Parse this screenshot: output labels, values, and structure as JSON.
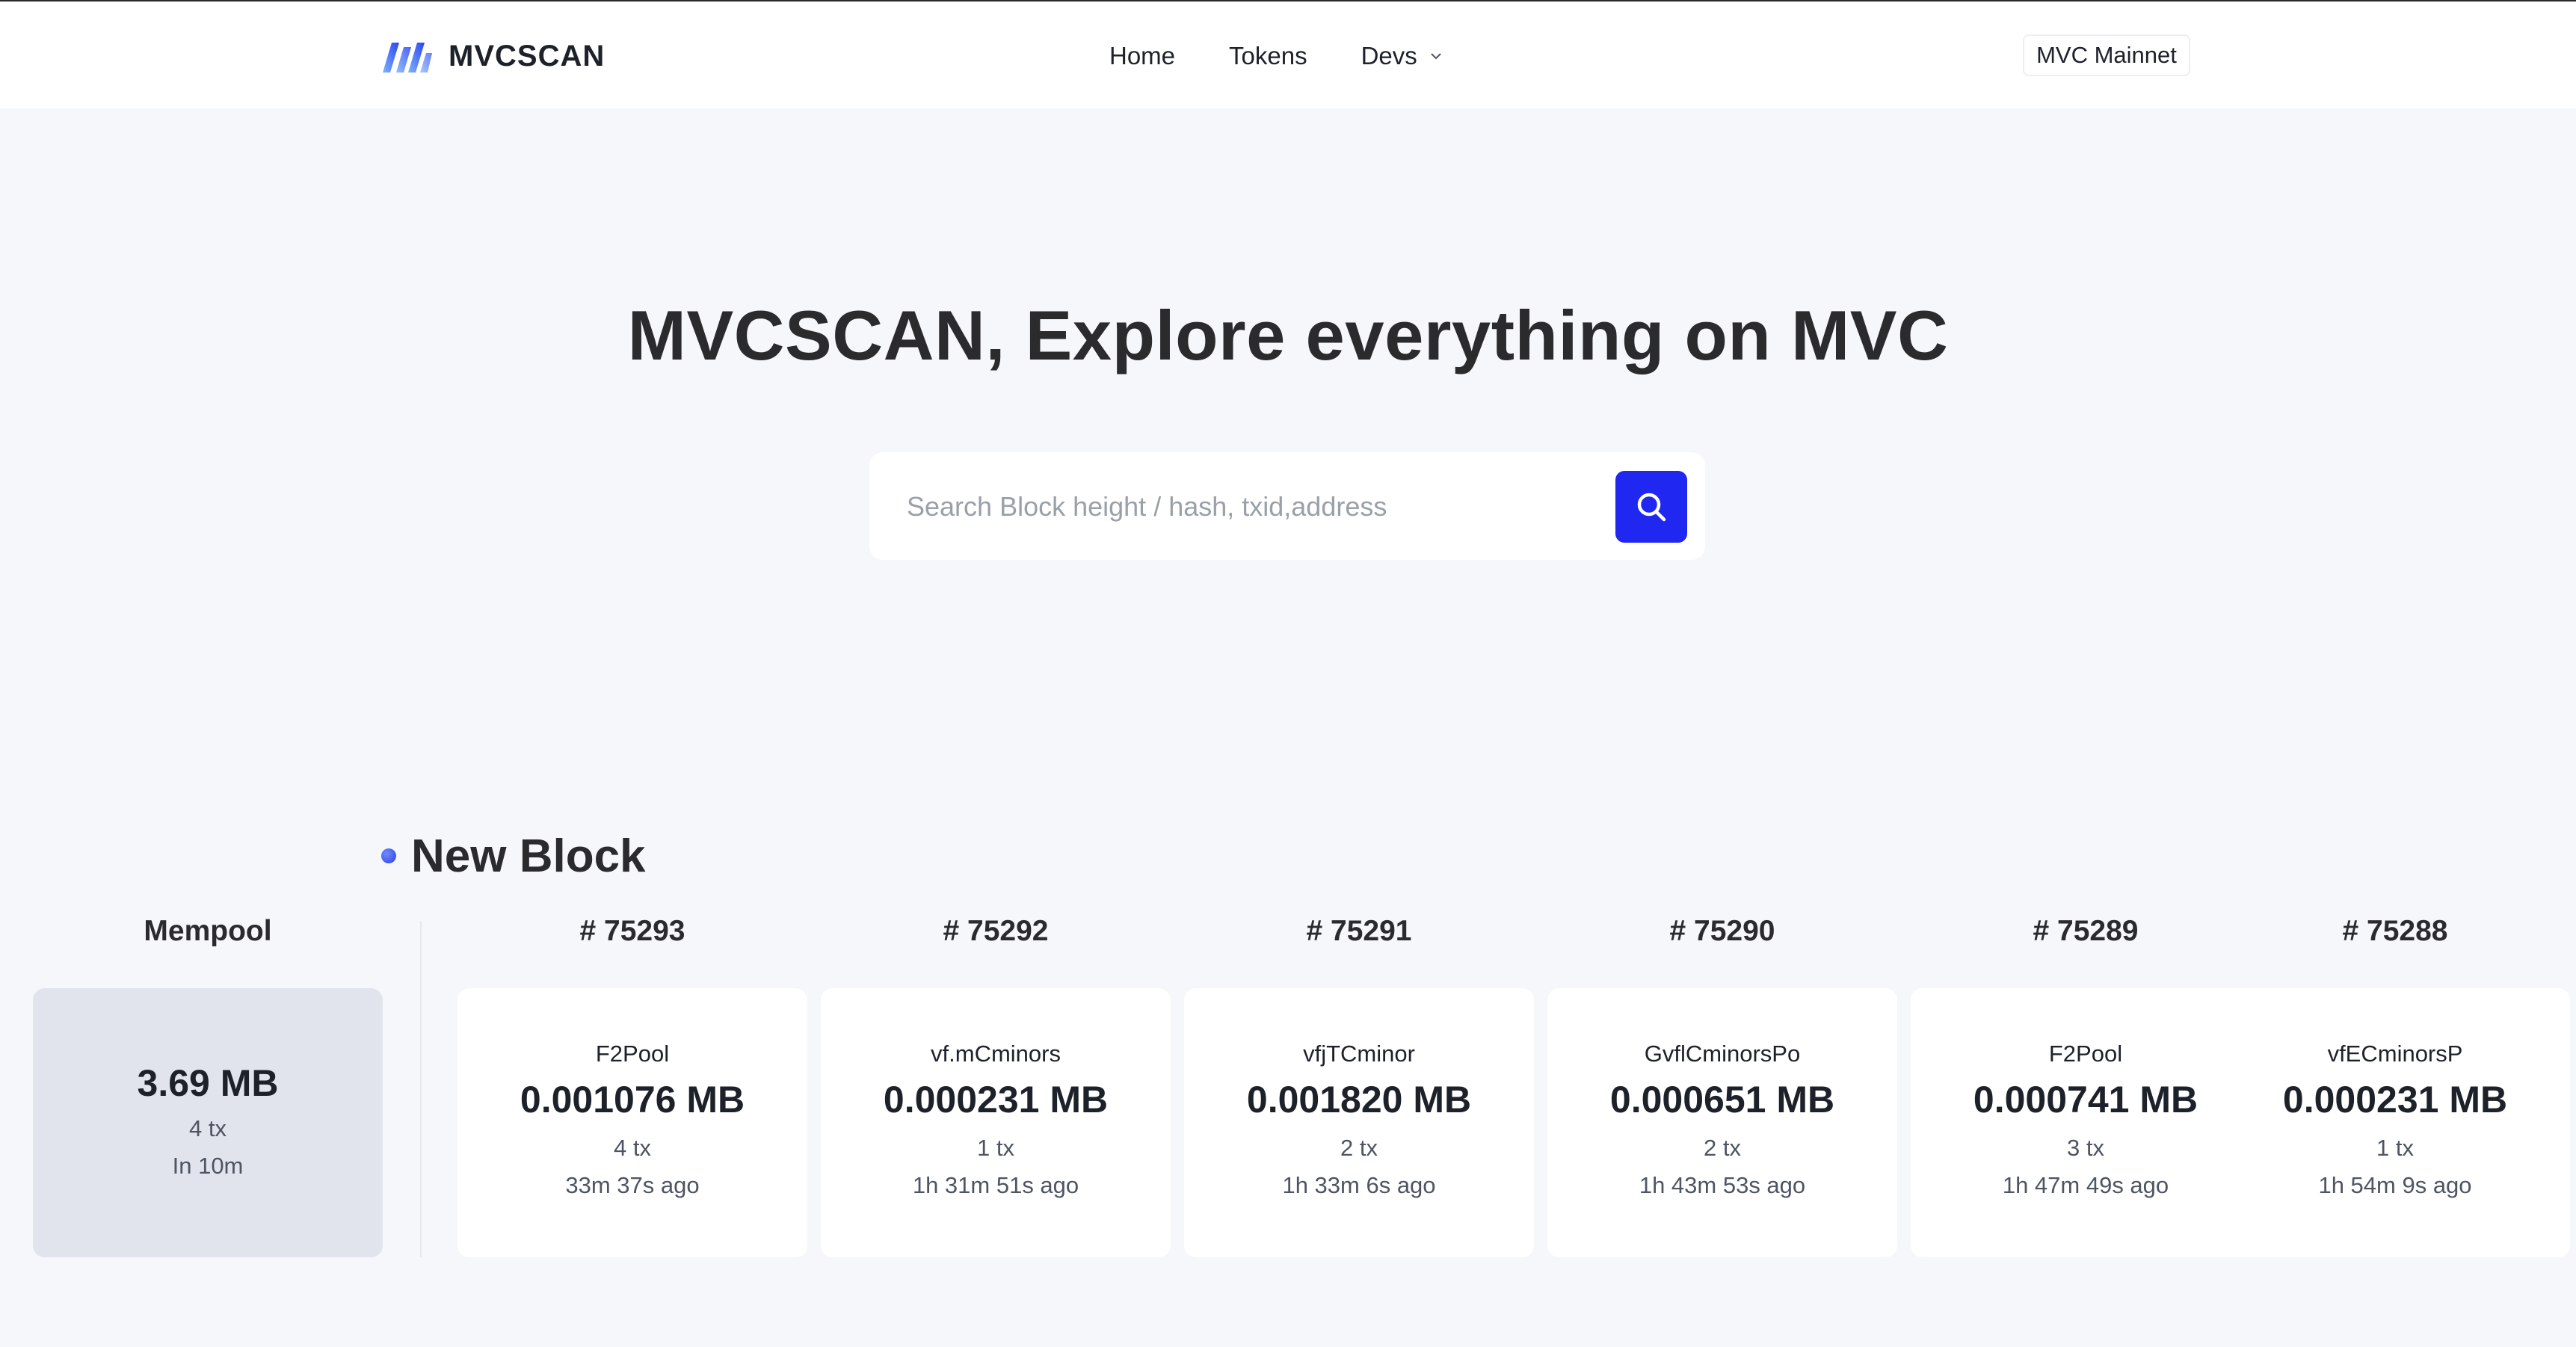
{
  "header": {
    "brand": "MVCSCAN",
    "nav": [
      "Home",
      "Tokens",
      "Devs"
    ],
    "network": "MVC Mainnet"
  },
  "hero": {
    "title": "MVCSCAN, Explore everything on MVC",
    "search_placeholder": "Search Block height / hash, txid,address"
  },
  "section": {
    "title": "New Block"
  },
  "mempool": {
    "label": "Mempool",
    "size": "3.69 MB",
    "tx": "4 tx",
    "eta": "In 10m"
  },
  "blocks": [
    {
      "height": "# 75293",
      "miner": "F2Pool",
      "size": "0.001076 MB",
      "tx": "4 tx",
      "ago": "33m 37s ago"
    },
    {
      "height": "# 75292",
      "miner": "vf.mCminors",
      "size": "0.000231 MB",
      "tx": "1 tx",
      "ago": "1h 31m 51s ago"
    },
    {
      "height": "# 75291",
      "miner": "vfjTCminor",
      "size": "0.001820 MB",
      "tx": "2 tx",
      "ago": "1h 33m 6s ago"
    },
    {
      "height": "# 75290",
      "miner": "GvflCminorsPo",
      "size": "0.000651 MB",
      "tx": "2 tx",
      "ago": "1h 43m 53s ago"
    },
    {
      "height": "# 75289",
      "miner": "F2Pool",
      "size": "0.000741 MB",
      "tx": "3 tx",
      "ago": "1h 47m 49s ago"
    },
    {
      "height": "# 75288",
      "miner": "vfECminorsP",
      "size": "0.000231 MB",
      "tx": "1 tx",
      "ago": "1h 54m 9s ago"
    }
  ],
  "colors": {
    "accent": "#1f27f0",
    "page_bg": "#f5f7fa",
    "mempool_bg": "#e1e4ec"
  }
}
